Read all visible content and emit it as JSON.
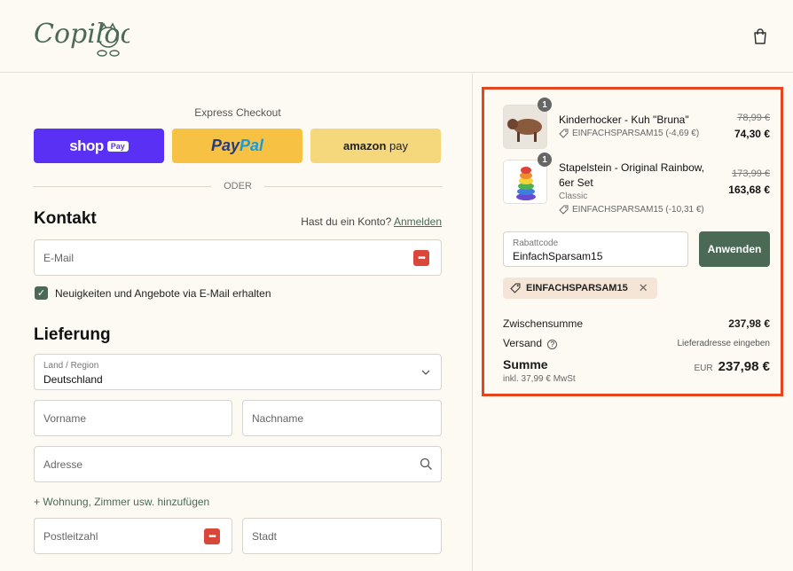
{
  "header": {
    "logo_text": "Copiloo",
    "cart_icon": "shopping-bag-icon"
  },
  "express": {
    "title": "Express Checkout",
    "shop_label": "shop",
    "shop_badge": "Pay",
    "paypal_a": "Pay",
    "paypal_b": "Pal",
    "amazon_a": "amazon",
    "amazon_b": " pay",
    "divider": "ODER"
  },
  "contact": {
    "heading": "Kontakt",
    "account_prompt": "Hast du ein Konto?",
    "login_link": "Anmelden",
    "email_placeholder": "E-Mail",
    "newsletter_label": "Neuigkeiten und Angebote via E-Mail erhalten",
    "newsletter_checked": true
  },
  "delivery": {
    "heading": "Lieferung",
    "country_label": "Land / Region",
    "country_value": "Deutschland",
    "firstname_placeholder": "Vorname",
    "lastname_placeholder": "Nachname",
    "address_placeholder": "Adresse",
    "add_apartment": "+ Wohnung, Zimmer usw. hinzufügen",
    "zip_placeholder": "Postleitzahl",
    "city_placeholder": "Stadt"
  },
  "cart": {
    "items": [
      {
        "qty": "1",
        "name": "Kinderhocker - Kuh \"Bruna\"",
        "variant": "",
        "discount": "EINFACHSPARSAM15 (-4,69 €)",
        "old_price": "78,99 €",
        "price": "74,30 €"
      },
      {
        "qty": "1",
        "name_line1": "Stapelstein - Original Rainbow,",
        "name_line2": "6er Set",
        "variant": "Classic",
        "discount": "EINFACHSPARSAM15 (-10,31 €)",
        "old_price": "173,99 €",
        "price": "163,68 €"
      }
    ],
    "discount_label": "Rabattcode",
    "discount_value": "EinfachSparsam15",
    "apply_button": "Anwenden",
    "applied_code": "EINFACHSPARSAM15",
    "subtotal_label": "Zwischensumme",
    "subtotal_value": "237,98 €",
    "shipping_label": "Versand",
    "shipping_value": "Lieferadresse eingeben",
    "total_label": "Summe",
    "tax_note": "inkl. 37,99 € MwSt",
    "currency": "EUR",
    "total_value": "237,98 €"
  },
  "colors": {
    "accent": "#4a6a55",
    "highlight": "#e5461f",
    "shop_pay": "#5a31f4",
    "paypal": "#f7c244",
    "amazon": "#f5d77c"
  }
}
